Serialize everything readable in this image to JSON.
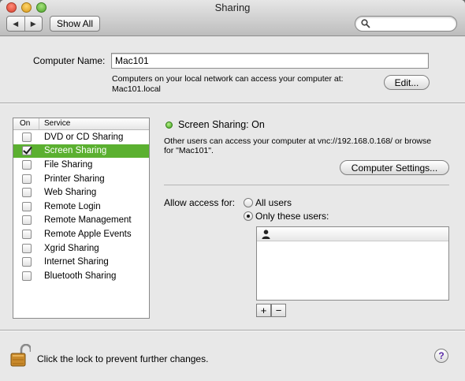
{
  "window": {
    "title": "Sharing"
  },
  "toolbar": {
    "back_glyph": "◀",
    "forward_glyph": "▶",
    "show_all_label": "Show All",
    "search_placeholder": ""
  },
  "computer_name": {
    "label": "Computer Name:",
    "value": "Mac101",
    "info_line1": "Computers on your local network can access your computer at:",
    "info_line2": "Mac101.local",
    "edit_label": "Edit..."
  },
  "services": {
    "header_on": "On",
    "header_service": "Service",
    "items": [
      {
        "label": "DVD or CD Sharing",
        "checked": false,
        "selected": false
      },
      {
        "label": "Screen Sharing",
        "checked": true,
        "selected": true
      },
      {
        "label": "File Sharing",
        "checked": false,
        "selected": false
      },
      {
        "label": "Printer Sharing",
        "checked": false,
        "selected": false
      },
      {
        "label": "Web Sharing",
        "checked": false,
        "selected": false
      },
      {
        "label": "Remote Login",
        "checked": false,
        "selected": false
      },
      {
        "label": "Remote Management",
        "checked": false,
        "selected": false
      },
      {
        "label": "Remote Apple Events",
        "checked": false,
        "selected": false
      },
      {
        "label": "Xgrid Sharing",
        "checked": false,
        "selected": false
      },
      {
        "label": "Internet Sharing",
        "checked": false,
        "selected": false
      },
      {
        "label": "Bluetooth Sharing",
        "checked": false,
        "selected": false
      }
    ]
  },
  "detail": {
    "status_title": "Screen Sharing: On",
    "status_color": "#3ea11a",
    "description_line1": "Other users can access your computer at vnc://192.168.0.168/ or browse",
    "description_line2": "for \"Mac101\".",
    "computer_settings_label": "Computer Settings...",
    "allow_access_label": "Allow access for:",
    "radio_all_users": "All users",
    "radio_only_these": "Only these users:",
    "selected_radio": "only_these",
    "add_glyph": "+",
    "remove_glyph": "−"
  },
  "footer": {
    "lock_text": "Click the lock to prevent further changes.",
    "help_glyph": "?"
  },
  "colors": {
    "selection": "#5bb030",
    "window_bg": "#e8e8e8"
  }
}
